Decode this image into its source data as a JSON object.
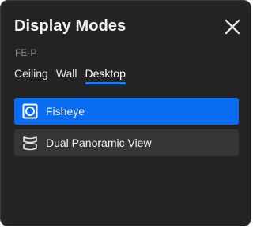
{
  "dialog": {
    "title": "Display Modes",
    "device_model": "FE-P"
  },
  "tabs": [
    {
      "label": "Ceiling",
      "active": false
    },
    {
      "label": "Wall",
      "active": false
    },
    {
      "label": "Desktop",
      "active": true
    }
  ],
  "options": [
    {
      "label": "Fisheye",
      "icon": "fisheye-icon",
      "selected": true
    },
    {
      "label": "Dual Panoramic View",
      "icon": "dual-panoramic-icon",
      "selected": false
    }
  ],
  "colors": {
    "background": "#232323",
    "accent": "#0a6cf0",
    "option_background": "#353535",
    "secondary_text": "#8a8a8a"
  }
}
